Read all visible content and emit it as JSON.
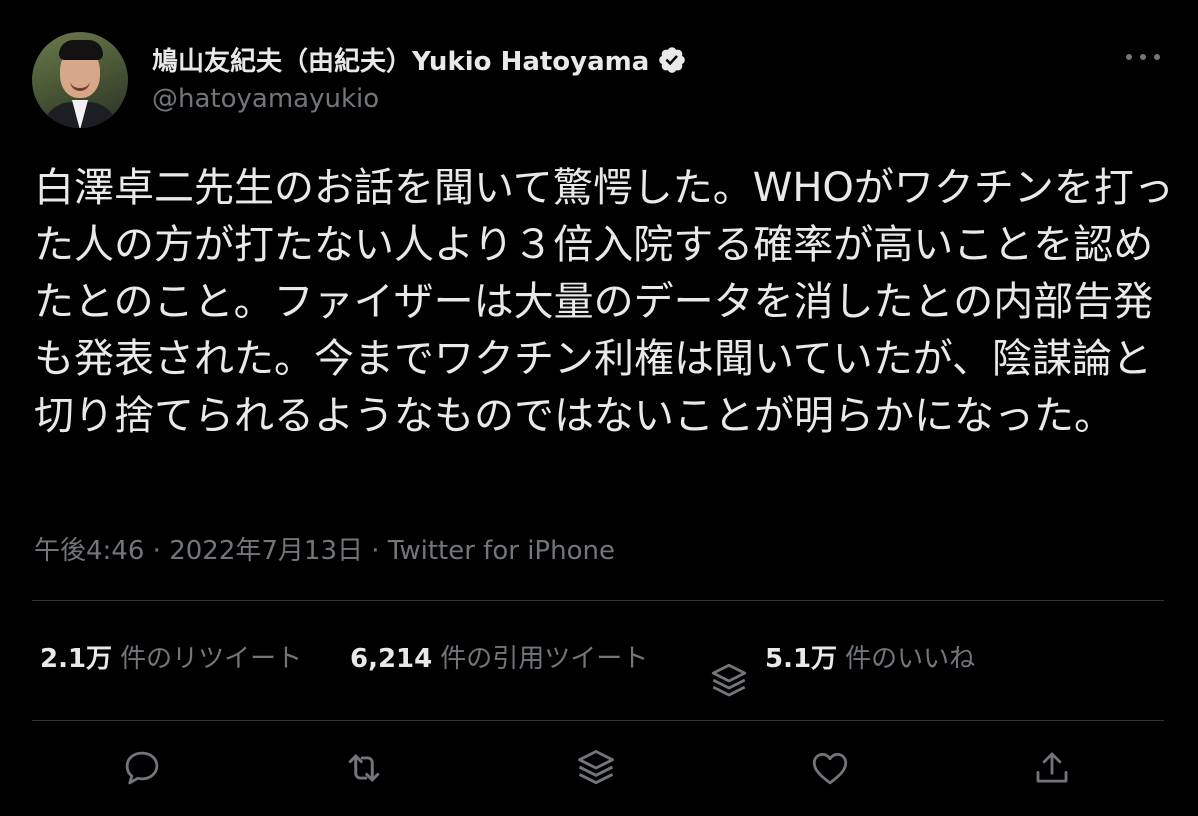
{
  "author": {
    "display_name": "鳩山友紀夫（由紀夫）Yukio Hatoyama",
    "handle": "@hatoyamayukio",
    "verified": true
  },
  "tweet": {
    "text": "白澤卓二先生のお話を聞いて驚愕した。WHOがワクチンを打った人の方が打たない人より３倍入院する確率が高いことを認めたとのこと。ファイザーは大量のデータを消したとの内部告発も発表された。今までワクチン利権は聞いていたが、陰謀論と切り捨てられるようなものではないことが明らかになった。",
    "time": "午後4:46",
    "separator": "·",
    "date": "2022年7月13日",
    "source": "Twitter for iPhone"
  },
  "stats": {
    "retweets": {
      "count": "2.1万",
      "label": "件のリツイート"
    },
    "quotes": {
      "count": "6,214",
      "label": "件の引用ツイート"
    },
    "likes": {
      "count": "5.1万",
      "label": "件のいいね"
    }
  },
  "icons": {
    "more": "more-options-icon",
    "verified": "verified-badge-icon",
    "reply": "reply-icon",
    "retweet": "retweet-icon",
    "layers": "layers-icon",
    "like": "heart-icon",
    "share": "share-icon"
  },
  "colors": {
    "background": "#000000",
    "text_primary": "#e7e9ea",
    "text_secondary": "#71767b",
    "divider": "#2f3336"
  }
}
